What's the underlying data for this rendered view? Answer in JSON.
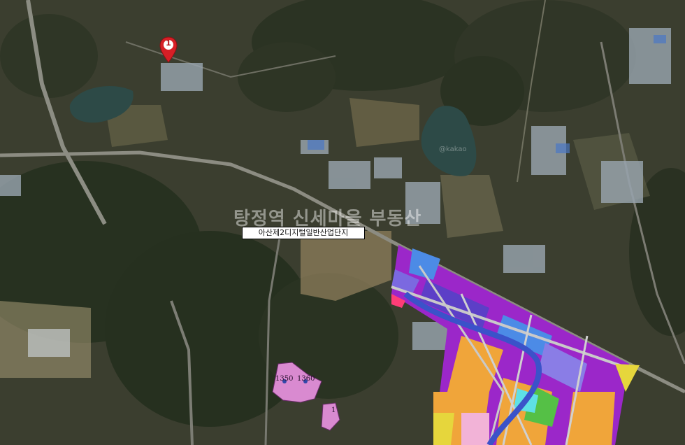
{
  "map": {
    "area_label": "아산제2디지털일반산업단지",
    "watermark": "탕정역 신세마을 부동산",
    "watermark_small": "@kakao",
    "marker": {
      "number": "1"
    },
    "lot_labels": [
      "1350",
      "1360",
      "1"
    ],
    "colors": {
      "industrial_purple": "#9b27c9",
      "blue_zone": "#4c8be6",
      "orange_zone": "#f0a53a",
      "green_zone": "#55c046",
      "pink_lot": "#d98ad0",
      "water": "#2d4a47",
      "marker_red": "#d61f26"
    }
  }
}
